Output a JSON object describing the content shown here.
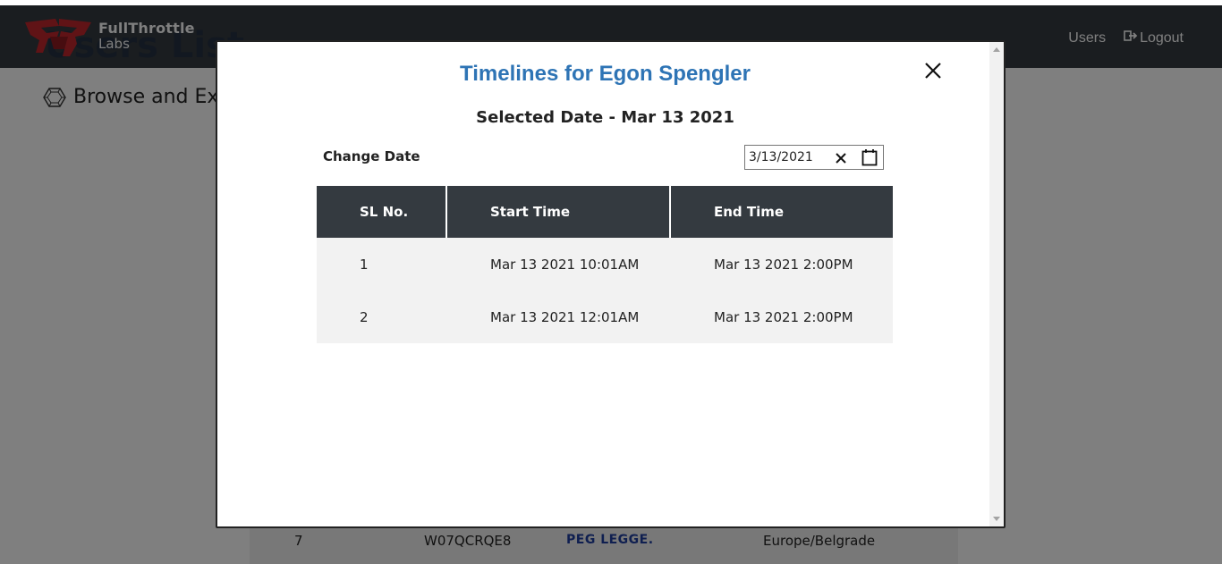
{
  "navbar": {
    "brand_line1": "FullThrottle",
    "brand_line2": "Labs",
    "ghost_title": "Users List",
    "links": [
      {
        "label": "Users",
        "icon": ""
      },
      {
        "label": "Logout",
        "icon": "logout-icon"
      }
    ]
  },
  "page": {
    "browse_text": "Browse and Ex",
    "background_row": {
      "index": "7",
      "id": "W07QCRQE8",
      "name": "PEG LEGGE.",
      "timezone": "Europe/Belgrade"
    }
  },
  "modal": {
    "title": "Timelines for Egon Spengler",
    "selected_date_label": "Selected Date -  Mar 13 2021",
    "change_date_label": "Change Date",
    "date_input_value": "3/13/2021",
    "table": {
      "headers": [
        "SL No.",
        "Start Time",
        "End Time"
      ],
      "rows": [
        {
          "sl": "1",
          "start": "Mar 13 2021 10:01AM",
          "end": "Mar 13 2021 2:00PM"
        },
        {
          "sl": "2",
          "start": "Mar 13 2021 12:01AM",
          "end": "Mar 13 2021 2:00PM"
        }
      ]
    }
  },
  "colors": {
    "navbar_bg": "#343a40",
    "modal_title": "#2e74b5",
    "brand_red": "#c0262d",
    "overlay": "rgba(0,0,0,0.5)"
  }
}
